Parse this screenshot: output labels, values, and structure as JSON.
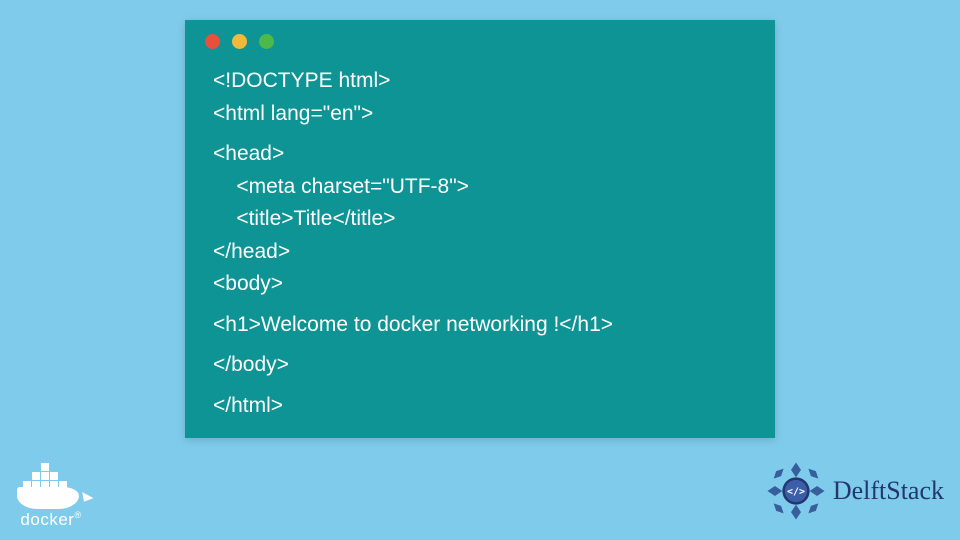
{
  "code": {
    "lines": [
      "<!DOCTYPE html>",
      "<html lang=\"en\">",
      "",
      "<head>",
      "    <meta charset=\"UTF-8\">",
      "    <title>Title</title>",
      "</head>",
      "<body>",
      "",
      "<h1>Welcome to docker networking !</h1>",
      "",
      "</body>",
      "",
      "</html>"
    ]
  },
  "docker": {
    "label": "docker",
    "reg": "®"
  },
  "delftstack": {
    "label": "DelftStack",
    "inner": "</>"
  },
  "colors": {
    "background": "#7fcbeb",
    "window": "#0e9494",
    "text": "#ffffff",
    "delft_blue": "#23366f"
  }
}
